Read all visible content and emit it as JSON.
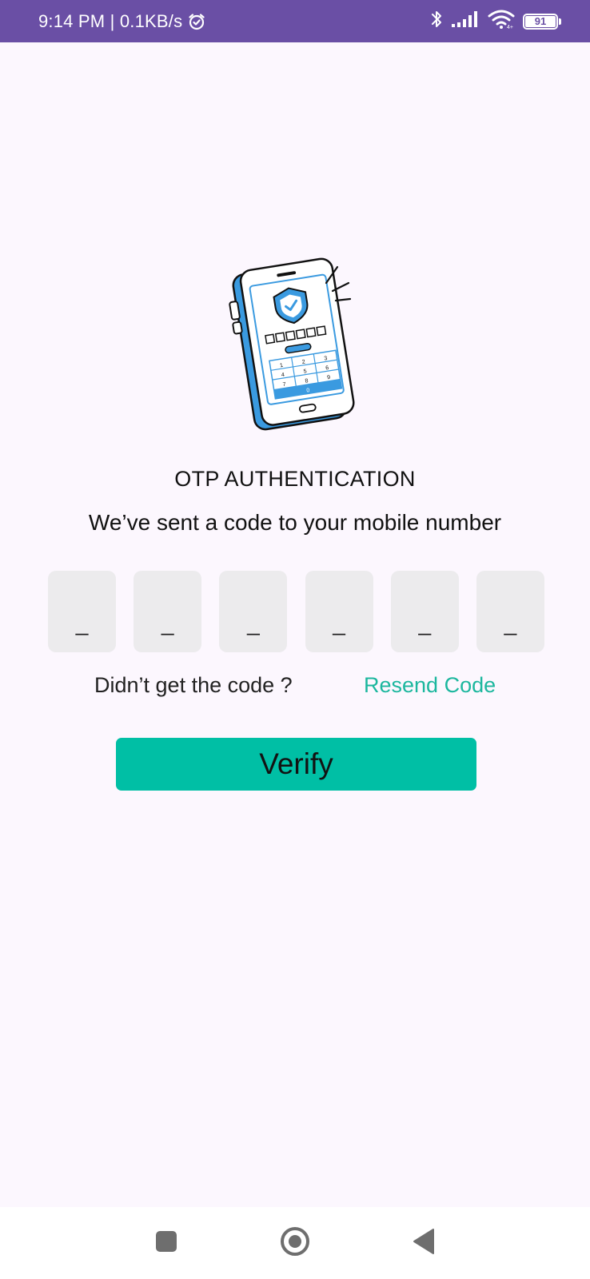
{
  "status_bar": {
    "time_speed": "9:14 PM | 0.1KB/s",
    "battery_level": "91",
    "icons": [
      "alarm-icon",
      "bluetooth-icon",
      "signal-icon",
      "wifi-icon",
      "battery-icon"
    ],
    "background_color": "#6A4FA5"
  },
  "main": {
    "illustration_icon": "phone-otp-shield-illustration",
    "title": "OTP AUTHENTICATION",
    "subtitle": "We’ve sent a code to your mobile number",
    "code_boxes": [
      "_",
      "_",
      "_",
      "_",
      "_",
      "_"
    ],
    "didnt_get_label": "Didn’t get the code ?",
    "resend_label": "Resend Code",
    "verify_label": "Verify"
  },
  "colors": {
    "background": "#FCF7FE",
    "accent": "#00BFA5",
    "resend_link": "#1CB79E",
    "code_box": "#ECEBED"
  },
  "nav_bar": {
    "icons": [
      "recents-icon",
      "home-icon",
      "back-icon"
    ]
  }
}
